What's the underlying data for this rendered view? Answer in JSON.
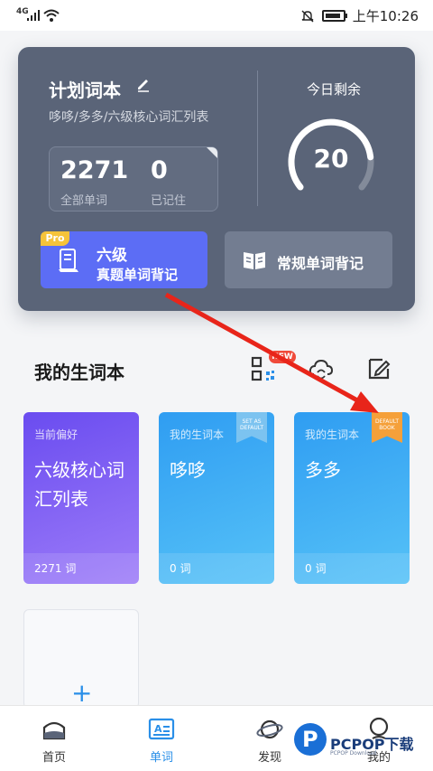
{
  "status_bar": {
    "network": "4G",
    "time": "上午10:26"
  },
  "plan": {
    "title": "计划词本",
    "subtitle": "哆哆/多多/六级核心词汇列表",
    "total_words": "2271",
    "total_label": "全部单词",
    "remembered": "0",
    "remembered_label": "已记住",
    "remaining_label": "今日剩余",
    "remaining_value": "20",
    "pro_badge": "Pro",
    "pro_line1": "六级",
    "pro_line2": "真题单词背记",
    "regular_label": "常规单词背记"
  },
  "section": {
    "title": "我的生词本",
    "new_badge": "NEW"
  },
  "books": [
    {
      "top": "当前偏好",
      "name": "六级核心词汇列表",
      "count": "2271 词"
    },
    {
      "top": "我的生词本",
      "name": "哆哆",
      "count": "0 词",
      "ribbon": "SET AS DEFAULT"
    },
    {
      "top": "我的生词本",
      "name": "多多",
      "count": "0 词",
      "ribbon": "DEFAULT BOOK"
    }
  ],
  "add_card": {
    "plus": "+"
  },
  "nav": [
    {
      "label": "首页",
      "icon": "home-icon"
    },
    {
      "label": "单词",
      "icon": "word-icon"
    },
    {
      "label": "发现",
      "icon": "planet-icon"
    },
    {
      "label": "我的",
      "icon": "profile-icon"
    }
  ],
  "watermark": {
    "brand": "PCPOP下载",
    "sub": "PCPOP Download"
  },
  "colors": {
    "accent": "#2a8fe8",
    "plan_bg": "#5a6478",
    "pro_btn": "#5c6df5",
    "arrow": "#e8251a"
  },
  "progress": {
    "remaining_fraction": 0.82
  }
}
